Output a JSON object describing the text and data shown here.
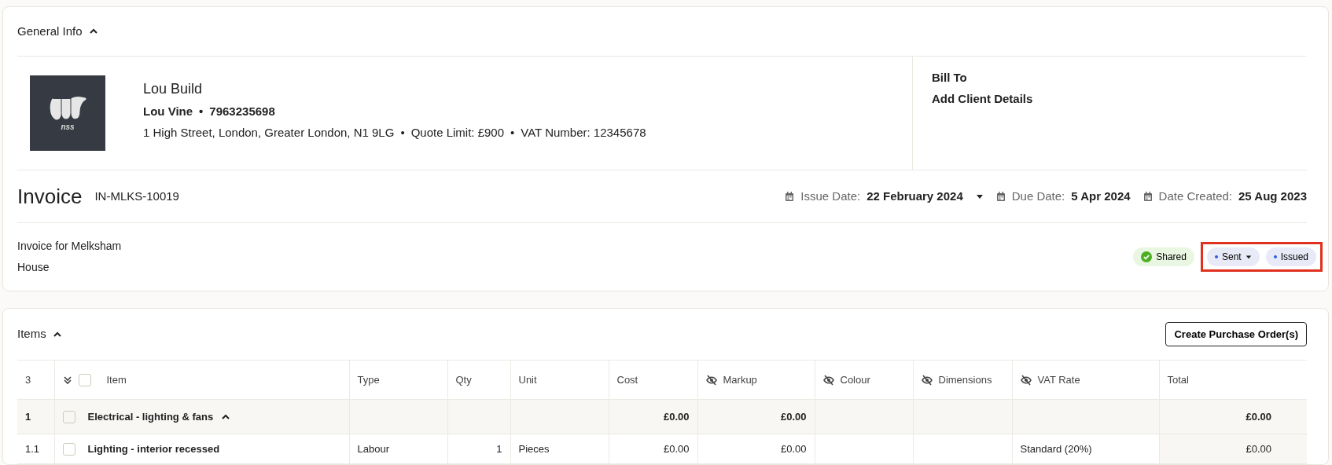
{
  "general_info": {
    "title": "General Info",
    "expanded": true
  },
  "company": {
    "name": "Lou Build",
    "contact": [
      {
        "text": "Lou Vine"
      },
      {
        "text": "7963235698"
      }
    ],
    "details": [
      {
        "text": "1 High Street, London, Greater London, N1 9LG"
      },
      {
        "text": "Quote Limit: £900"
      },
      {
        "text": "VAT Number: 12345678"
      }
    ],
    "separator": "•",
    "logo_text": "nss"
  },
  "bill_to": {
    "label": "Bill To",
    "value": "Add Client Details"
  },
  "invoice": {
    "title": "Invoice",
    "number": "IN-MLKS-10019",
    "dates": [
      {
        "label": "Issue Date:",
        "value": "22 February 2024",
        "dropdown": true
      },
      {
        "label": "Due Date:",
        "value": "5 Apr 2024",
        "dropdown": false
      },
      {
        "label": "Date Created:",
        "value": "25 Aug 2023",
        "dropdown": false
      }
    ],
    "description": "Invoice for Melksham House",
    "statuses": [
      {
        "label": "Shared",
        "kind": "check",
        "dropdown": false,
        "highlighted": false
      },
      {
        "label": "Sent",
        "kind": "dot",
        "dropdown": true,
        "highlighted": true
      },
      {
        "label": "Issued",
        "kind": "dot",
        "dropdown": false,
        "highlighted": true
      }
    ]
  },
  "items": {
    "title": "Items",
    "expanded": true,
    "button": "Create Purchase Order(s)",
    "count": "3",
    "select_all_checked": false,
    "columns": [
      {
        "label": "Item",
        "hidden": false
      },
      {
        "label": "Type",
        "hidden": false
      },
      {
        "label": "Qty",
        "hidden": false
      },
      {
        "label": "Unit",
        "hidden": false
      },
      {
        "label": "Cost",
        "hidden": false
      },
      {
        "label": "Markup",
        "hidden": true
      },
      {
        "label": "Colour",
        "hidden": true
      },
      {
        "label": "Dimensions",
        "hidden": true
      },
      {
        "label": "VAT Rate",
        "hidden": true
      },
      {
        "label": "Total",
        "hidden": false
      }
    ],
    "rows": [
      {
        "number": "1",
        "kind": "group",
        "checked": false,
        "expanded": true,
        "cells": [
          "Electrical - lighting & fans",
          "",
          "",
          "",
          "£0.00",
          "£0.00",
          "",
          "",
          "",
          "£0.00"
        ]
      },
      {
        "number": "1.1",
        "kind": "item",
        "checked": false,
        "cells": [
          "Lighting - interior recessed",
          "Labour",
          "1",
          "Pieces",
          "£0.00",
          "£0.00",
          "",
          "",
          "Standard (20%)",
          "£0.00"
        ]
      }
    ]
  }
}
